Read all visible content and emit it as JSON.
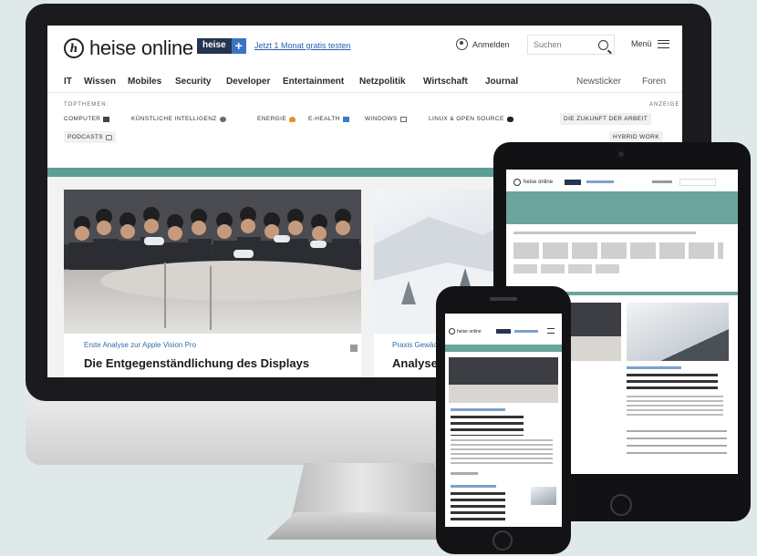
{
  "site": {
    "logo_mark": "h",
    "logo_text": "heise online",
    "plus_word": "heise",
    "plus_sign": "+",
    "promo_link": "Jetzt 1 Monat gratis testen",
    "login": "Anmelden",
    "search_placeholder": "Suchen",
    "menu": "Menü"
  },
  "nav": {
    "items": [
      "IT",
      "Wissen",
      "Mobiles",
      "Security",
      "Developer",
      "Entertainment",
      "Netzpolitik",
      "Wirtschaft",
      "Journal"
    ],
    "right_items": [
      "Newsticker",
      "Foren"
    ]
  },
  "topics": {
    "label": "TOPTHEMEN:",
    "ad_label": "ANZEIGE",
    "chips": [
      "COMPUTER",
      "KÜNSTLICHE INTELLIGENZ",
      "ENERGIE",
      "E-HEALTH",
      "WINDOWS",
      "LINUX & OPEN SOURCE",
      "PODCASTS"
    ],
    "ad_chips": [
      "DIE ZUKUNFT DER ARBEIT",
      "HYBRID WORK"
    ]
  },
  "articles": [
    {
      "kicker": "Erste Analyse zur Apple Vision Pro",
      "title": "Die Entgegenständlichung des Displays"
    },
    {
      "kicker": "Praxis Gewächshaus",
      "title": "Analyse"
    }
  ],
  "colors": {
    "teal": "#5e9d96",
    "link": "#2f6da9",
    "background": "#dfe9ea"
  }
}
